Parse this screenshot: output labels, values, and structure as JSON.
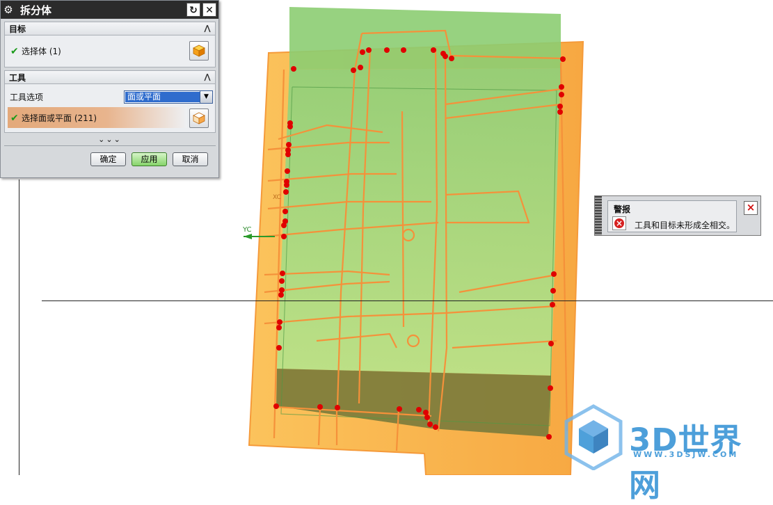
{
  "dialog": {
    "title": "拆分体",
    "target_section": "目标",
    "select_body": "选择体 (1)",
    "tool_section": "工具",
    "tool_option_label": "工具选项",
    "tool_option_value": "面或平面",
    "select_face": "选择面或平面 (211)",
    "more": "⌄⌄⌄",
    "ok": "确定",
    "apply": "应用",
    "cancel": "取消",
    "icons": [
      "gear-icon",
      "reset-icon",
      "close-icon",
      "collapse-icon",
      "check-icon",
      "cube-icon",
      "dropdown-arrow-icon"
    ]
  },
  "warning": {
    "title": "警报",
    "message": "工具和目标未形成全相交。",
    "close": "×"
  },
  "viewport": {
    "axis_y": "YC",
    "axis_x": "XC"
  },
  "watermark": {
    "brand": "3D世界网",
    "url": "WWW.3DSJW.COM"
  },
  "colors": {
    "solid_green": "#9fd67a",
    "solid_orange": "#f7b84a",
    "edge_orange": "#f59a3a",
    "points": "#e00000"
  }
}
